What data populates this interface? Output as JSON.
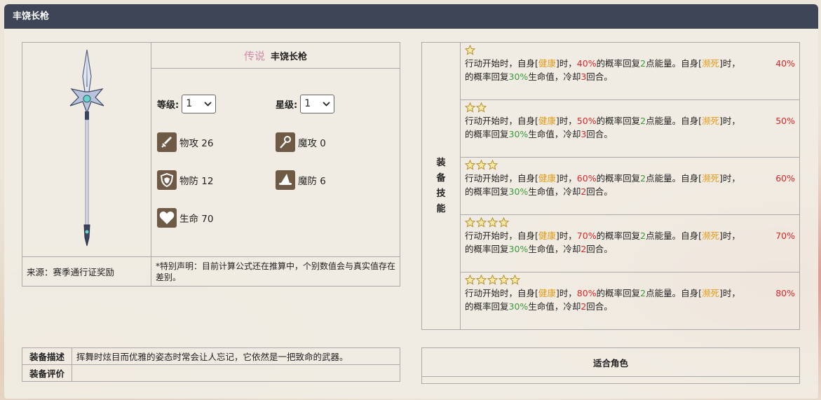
{
  "header": {
    "title": "丰饶长枪"
  },
  "item": {
    "rarity": "传说",
    "name": "丰饶长枪",
    "level_label": "等级:",
    "level_value": "1",
    "star_label": "星级:",
    "star_value": "1",
    "stats": [
      {
        "label": "物攻 26",
        "icon": "sword-icon"
      },
      {
        "label": "魔攻 0",
        "icon": "staff-icon"
      },
      {
        "label": "物防 12",
        "icon": "shield-icon"
      },
      {
        "label": "魔防 6",
        "icon": "wizard-hat-icon"
      },
      {
        "label": "生命 70",
        "icon": "heart-icon"
      }
    ],
    "source": "来源：赛季通行证奖励",
    "note": "*特别声明：目前计算公式还在推算中，个别数值会与真实值存在差别。"
  },
  "skills": {
    "label": "装备技能",
    "label_chars": [
      "装",
      "备",
      "技",
      "能"
    ],
    "rows": [
      {
        "stars": 1,
        "p1": "行动开始时，自身[",
        "h": "健康",
        "p2": "]时，",
        "pct1": "40%",
        "p3": "的概率回复",
        "energy": "2",
        "p4": "点能量。自身[",
        "d": "濒死",
        "p5": "]时，",
        "pct2": "40%",
        "p6": "的概率回复",
        "hp": "30%",
        "p7": "生命值，冷却",
        "cd": "3",
        "p8": "回合。"
      },
      {
        "stars": 2,
        "p1": "行动开始时，自身[",
        "h": "健康",
        "p2": "]时，",
        "pct1": "50%",
        "p3": "的概率回复",
        "energy": "2",
        "p4": "点能量。自身[",
        "d": "濒死",
        "p5": "]时，",
        "pct2": "50%",
        "p6": "的概率回复",
        "hp": "30%",
        "p7": "生命值，冷却",
        "cd": "3",
        "p8": "回合。"
      },
      {
        "stars": 3,
        "p1": "行动开始时，自身[",
        "h": "健康",
        "p2": "]时，",
        "pct1": "60%",
        "p3": "的概率回复",
        "energy": "2",
        "p4": "点能量。自身[",
        "d": "濒死",
        "p5": "]时，",
        "pct2": "60%",
        "p6": "的概率回复",
        "hp": "30%",
        "p7": "生命值，冷却",
        "cd": "2",
        "p8": "回合。"
      },
      {
        "stars": 4,
        "p1": "行动开始时，自身[",
        "h": "健康",
        "p2": "]时，",
        "pct1": "70%",
        "p3": "的概率回复",
        "energy": "2",
        "p4": "点能量。自身[",
        "d": "濒死",
        "p5": "]时，",
        "pct2": "70%",
        "p6": "的概率回复",
        "hp": "30%",
        "p7": "生命值，冷却",
        "cd": "2",
        "p8": "回合。"
      },
      {
        "stars": 5,
        "p1": "行动开始时，自身[",
        "h": "健康",
        "p2": "]时，",
        "pct1": "80%",
        "p3": "的概率回复",
        "energy": "2",
        "p4": "点能量。自身[",
        "d": "濒死",
        "p5": "]时，",
        "pct2": "80%",
        "p6": "的概率回复",
        "hp": "30%",
        "p7": "生命值，冷却",
        "cd": "2",
        "p8": "回合。"
      }
    ]
  },
  "description": {
    "desc_label": "装备描述",
    "desc_value": "挥舞时炫目而优雅的姿态时常会让人忘记，它依然是一把致命的武器。",
    "eval_label": "装备评价",
    "eval_value": ""
  },
  "roles": {
    "title": "适合角色"
  },
  "colors": {
    "header_bg": "#3e4557",
    "healthy": "#e49b19",
    "percent": "#e02525",
    "green": "#3a9a3a",
    "rarity": "#d18aa8"
  }
}
